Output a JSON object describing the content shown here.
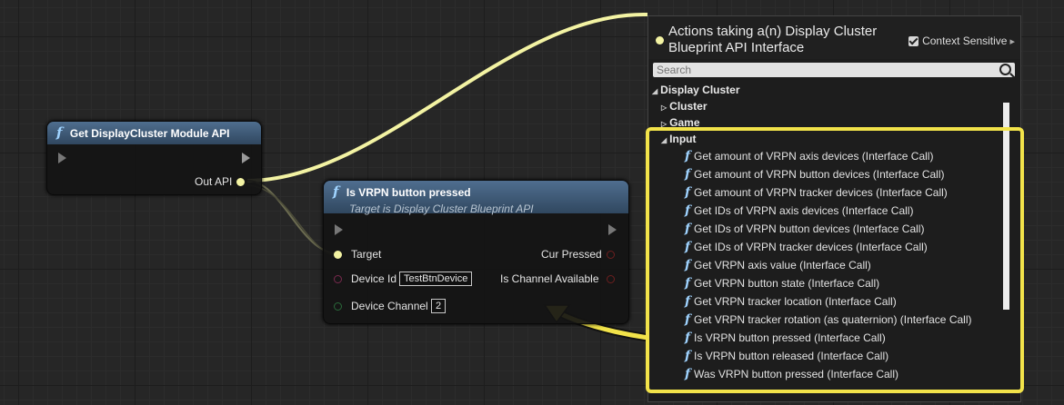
{
  "node_get_module": {
    "title": "Get DisplayCluster Module API",
    "out_pin_label": "Out API"
  },
  "node_is_pressed": {
    "title": "Is VRPN button pressed",
    "subtitle": "Target is Display Cluster Blueprint API",
    "target_label": "Target",
    "device_id_label": "Device Id",
    "device_id_value": "TestBtnDevice",
    "device_channel_label": "Device Channel",
    "device_channel_value": "2",
    "cur_pressed_label": "Cur Pressed",
    "is_channel_available_label": "Is Channel Available"
  },
  "actions_panel": {
    "title": "Actions taking a(n) Display Cluster Blueprint API Interface",
    "context_sensitive_label": "Context Sensitive",
    "search_placeholder": "Search",
    "root_category": "Display Cluster",
    "categories": [
      "Cluster",
      "Game",
      "Input"
    ],
    "items": [
      "Get amount of VRPN axis devices (Interface Call)",
      "Get amount of VRPN button devices (Interface Call)",
      "Get amount of VRPN tracker devices (Interface Call)",
      "Get IDs of VRPN axis devices (Interface Call)",
      "Get IDs of VRPN button devices (Interface Call)",
      "Get IDs of VRPN tracker devices (Interface Call)",
      "Get VRPN axis value (Interface Call)",
      "Get VRPN button state (Interface Call)",
      "Get VRPN tracker location (Interface Call)",
      "Get VRPN tracker rotation (as quaternion) (Interface Call)",
      "Is VRPN button pressed (Interface Call)",
      "Is VRPN button released (Interface Call)",
      "Was VRPN button pressed (Interface Call)"
    ]
  },
  "colors": {
    "highlight": "#f2e34a",
    "wire": "#f3f3a3",
    "node_header": "#3d5873"
  },
  "icons": {
    "function": "f",
    "search": "search-icon",
    "expand": "▷",
    "collapse": "◢",
    "arrow_right": "▸"
  }
}
